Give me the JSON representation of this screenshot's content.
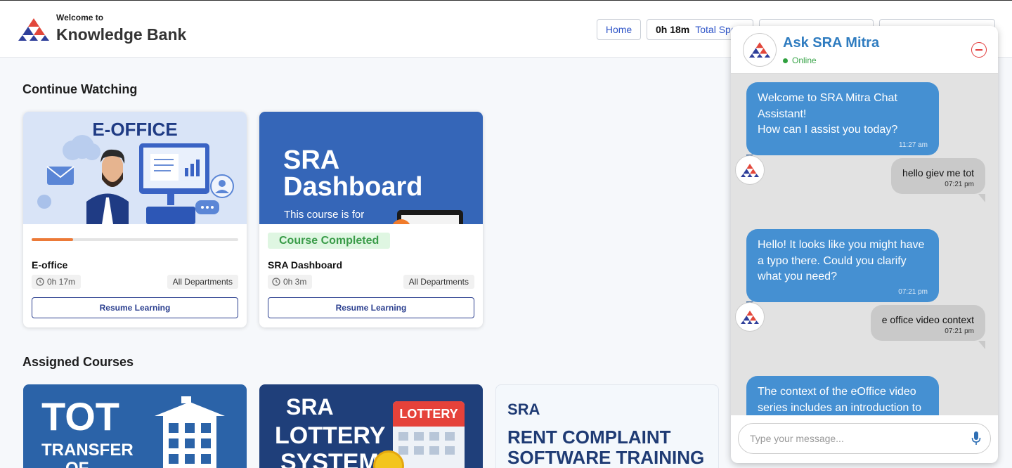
{
  "header": {
    "welcome": "Welcome to",
    "brand": "Knowledge Bank",
    "home_label": "Home",
    "time_value": "0h 18m",
    "time_label": "Total Spent"
  },
  "continue_watching": {
    "title": "Continue Watching",
    "cards": [
      {
        "thumb_title": "E-OFFICE",
        "title": "E-office",
        "duration": "0h 17m",
        "department": "All Departments",
        "button": "Resume Learning",
        "progress": 0.2
      },
      {
        "thumb_line1": "SRA",
        "thumb_line2": "Dashboard",
        "thumb_sub": "This course is for",
        "badge": "Course Completed",
        "title": "SRA Dashboard",
        "duration": "0h 3m",
        "department": "All Departments",
        "button": "Resume Learning"
      }
    ]
  },
  "assigned_courses": {
    "title": "Assigned Courses",
    "cards": [
      {
        "line1": "TOT",
        "line2": "TRANSFER",
        "line3": "OF"
      },
      {
        "line1": "SRA",
        "line2": "LOTTERY",
        "line3": "SYSTEM",
        "badge": "LOTTERY"
      },
      {
        "line1": "SRA",
        "line2": "RENT COMPLAINT",
        "line3": "SOFTWARE TRAINING"
      }
    ]
  },
  "chat": {
    "title": "Ask SRA Mitra",
    "status": "Online",
    "input_placeholder": "Type your message...",
    "messages": [
      {
        "from": "bot",
        "lines": [
          "Welcome to SRA Mitra Chat",
          "Assistant!",
          "How can I assist you today?"
        ],
        "time": "11:27 am"
      },
      {
        "from": "user",
        "text": "hello giev me tot",
        "time": "07:21 pm"
      },
      {
        "from": "bot",
        "lines": [
          "Hello! It looks like you might have",
          "a typo there. Could you clarify",
          "what you need?"
        ],
        "time": "07:21 pm"
      },
      {
        "from": "user",
        "text": "e office video context",
        "time": "07:21 pm"
      },
      {
        "from": "bot",
        "lines": [
          "The context of the eOffice video",
          "series includes an introduction to"
        ],
        "time": ""
      }
    ]
  },
  "colors": {
    "accent": "#2f55c8",
    "chat_bubble": "#4590d2",
    "progress": "#ec7a38",
    "completed": "#3a9c49"
  },
  "icons": [
    "sra-logo-icon",
    "clock-icon",
    "minus-circle-icon",
    "microphone-icon"
  ]
}
